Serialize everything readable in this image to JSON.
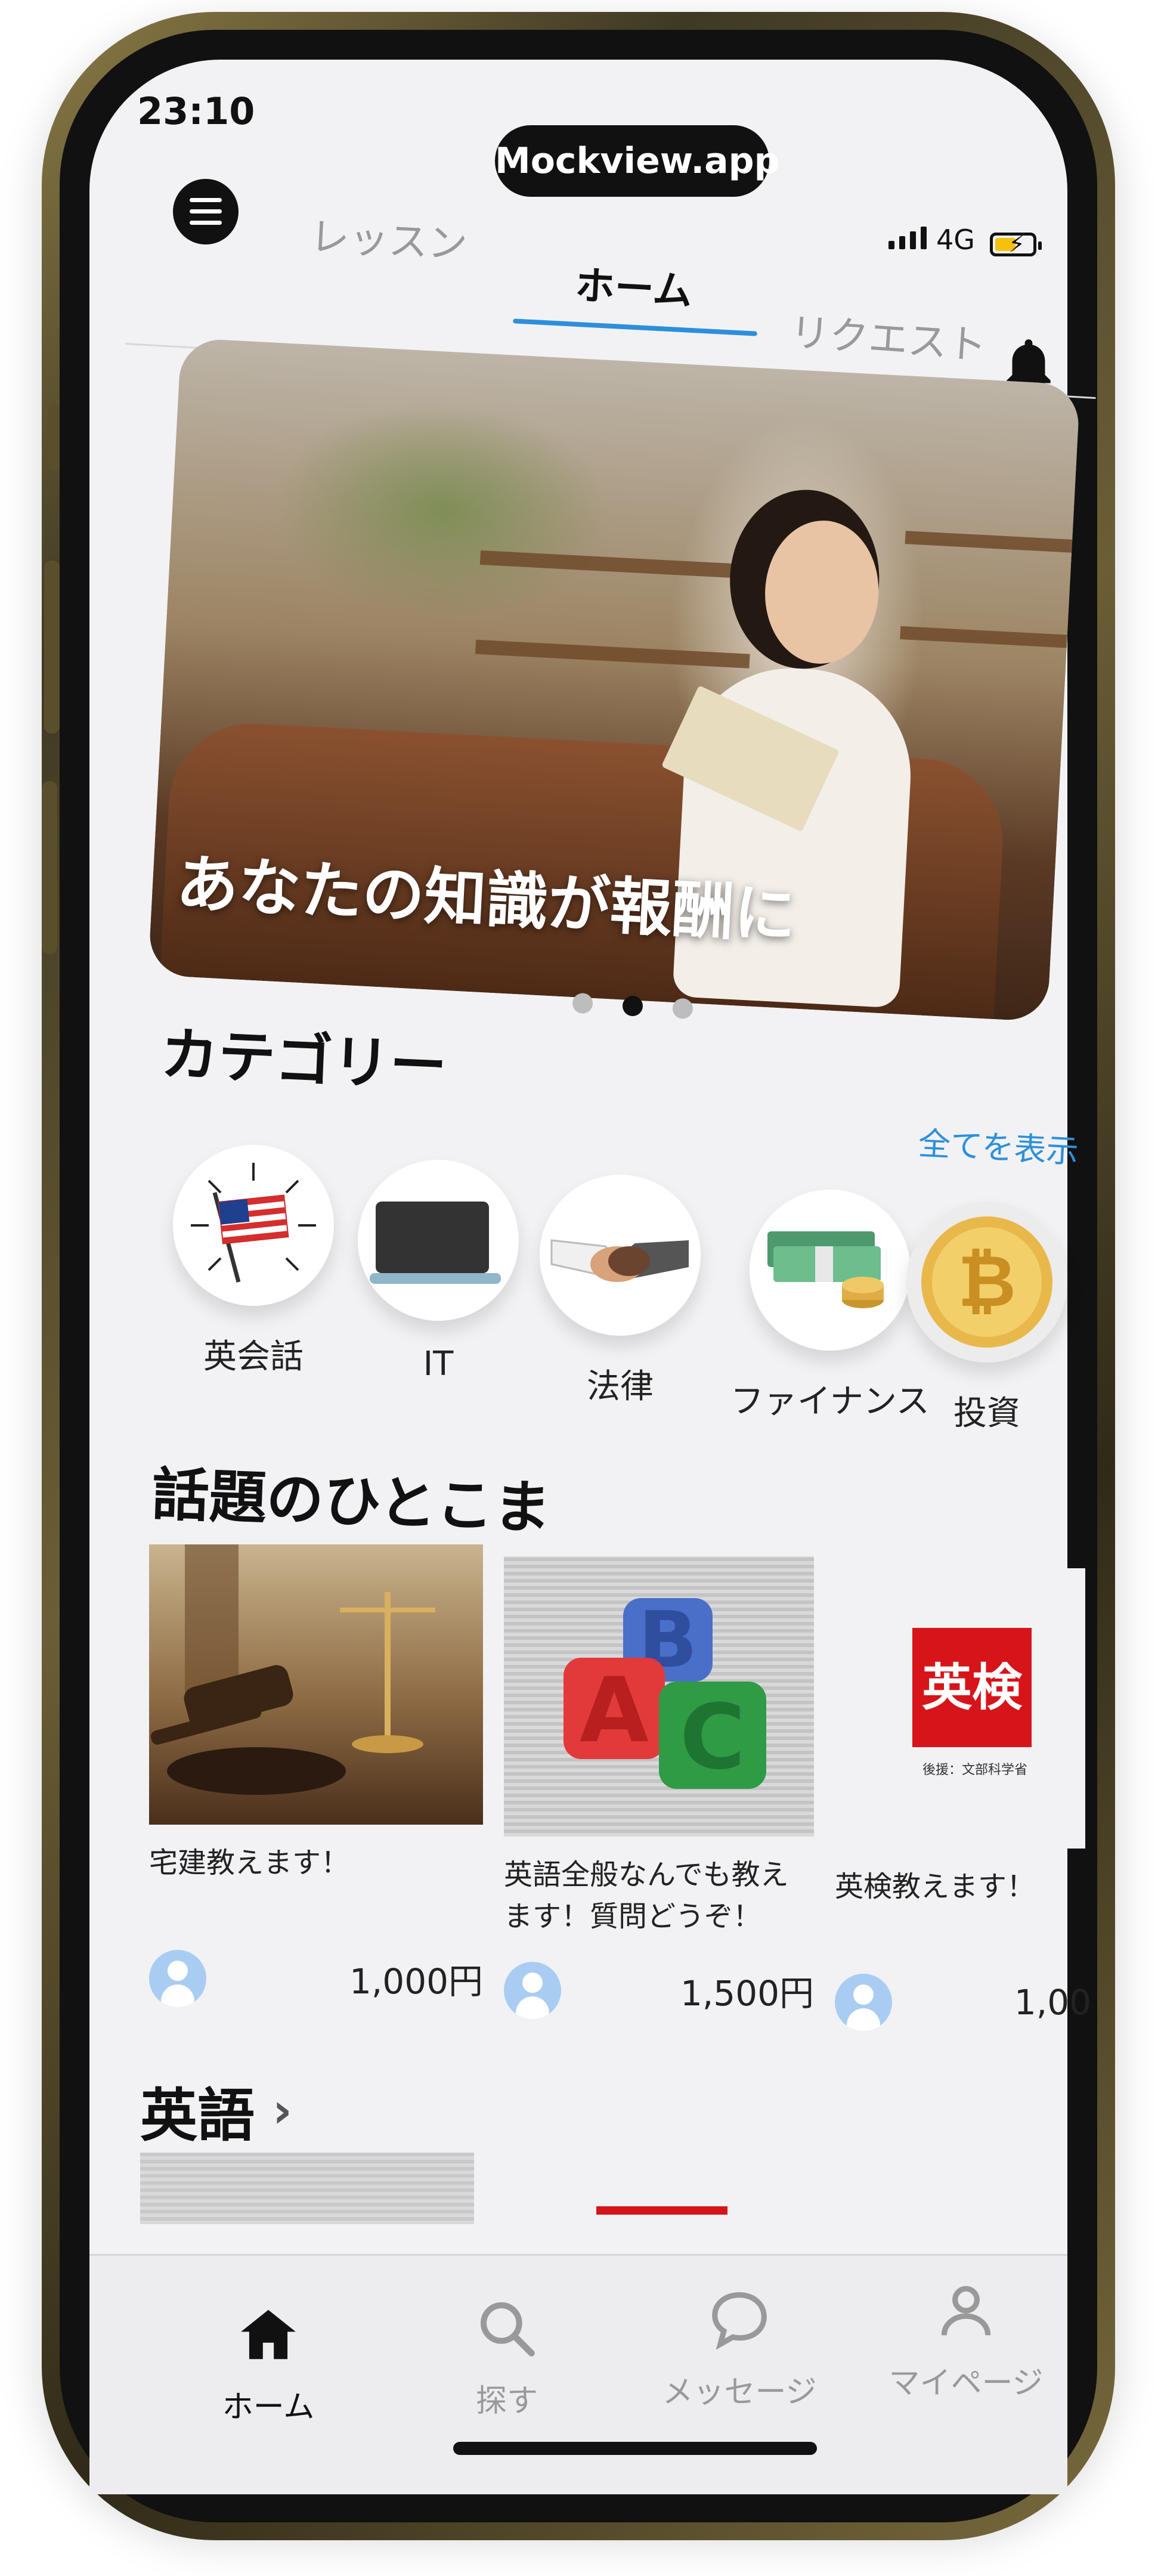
{
  "status": {
    "time": "23:10",
    "network": "4G"
  },
  "watermark": "Mockview.app",
  "header": {
    "tabs": [
      {
        "label": "レッスン"
      },
      {
        "label": "ホーム"
      },
      {
        "label": "リクエスト"
      }
    ],
    "active_tab": "ホーム"
  },
  "hero": {
    "caption": "あなたの知識が報酬に",
    "slide_count": 3,
    "active_slide": 2
  },
  "categories": {
    "title": "カテゴリー",
    "see_all": "全てを表示",
    "items": [
      {
        "label": "英会話",
        "icon": "american-flag-icon"
      },
      {
        "label": "IT",
        "icon": "laptop-icon"
      },
      {
        "label": "法律",
        "icon": "handshake-icon"
      },
      {
        "label": "ファイナンス",
        "icon": "money-stack-icon"
      },
      {
        "label": "投資",
        "icon": "bitcoin-icon"
      }
    ]
  },
  "featured": {
    "title": "話題のひとこま",
    "cards": [
      {
        "title": "宅建教えます！",
        "price": "1,000円"
      },
      {
        "title": "英語全般なんでも教えます！質問どうぞ！",
        "price": "1,500円"
      },
      {
        "title": "英検教えます！",
        "price": "1,00",
        "logo_text": "英検",
        "logo_caption": "後援：文部科学省"
      }
    ]
  },
  "english_section": {
    "title": "英語"
  },
  "bottom_nav": [
    {
      "label": "ホーム",
      "icon": "home-icon"
    },
    {
      "label": "探す",
      "icon": "search-icon"
    },
    {
      "label": "メッセージ",
      "icon": "chat-bubble-icon"
    },
    {
      "label": "マイページ",
      "icon": "person-icon"
    }
  ],
  "colors": {
    "accent": "#2d8fdc",
    "eiken_red": "#d7141a"
  }
}
